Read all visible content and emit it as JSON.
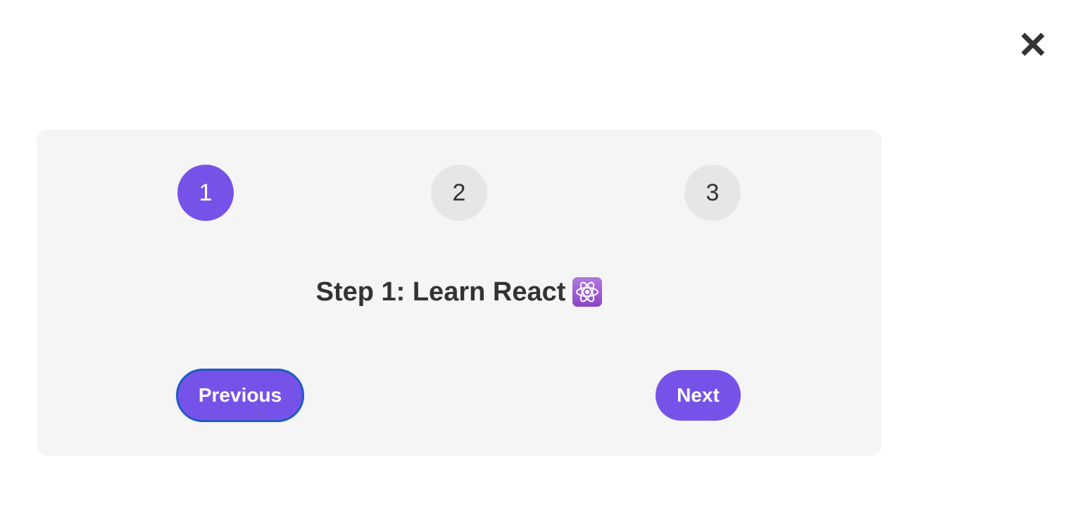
{
  "close": {
    "icon": "close-icon"
  },
  "steps": [
    {
      "label": "1",
      "active": true
    },
    {
      "label": "2",
      "active": false
    },
    {
      "label": "3",
      "active": false
    }
  ],
  "content": {
    "heading": "Step 1: Learn React",
    "icon": "atom-icon"
  },
  "buttons": {
    "previous": "Previous",
    "next": "Next"
  },
  "colors": {
    "accent": "#7752e8",
    "inactive_step": "#e6e6e6",
    "card_background": "#f5f5f5",
    "text": "#333333",
    "focus_ring": "#1e5bc6"
  }
}
